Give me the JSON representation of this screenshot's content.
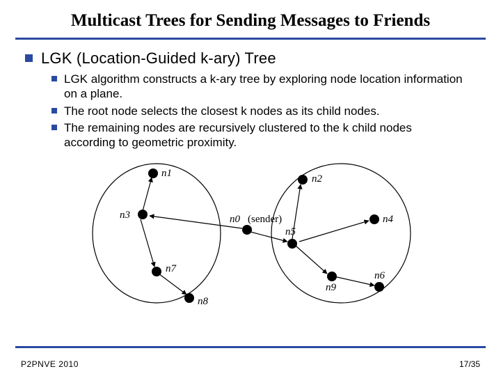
{
  "title": "Multicast Trees for Sending Messages to Friends",
  "section": "LGK (Location-Guided k-ary) Tree",
  "bullets": [
    "LGK algorithm constructs a k-ary tree by exploring node location information on a plane.",
    "The root node selects the closest k nodes as its child nodes.",
    "The remaining nodes are recursively clustered to the k child nodes according to geometric proximity."
  ],
  "diagram": {
    "sender_label": "(sender)",
    "nodes": {
      "n0": "n0",
      "n1": "n1",
      "n2": "n2",
      "n3": "n3",
      "n4": "n4",
      "n5": "n5",
      "n6": "n6",
      "n7": "n7",
      "n8": "n8",
      "n9": "n9"
    }
  },
  "footer": {
    "left": "P2PNVE 2010",
    "right": "17/35"
  }
}
